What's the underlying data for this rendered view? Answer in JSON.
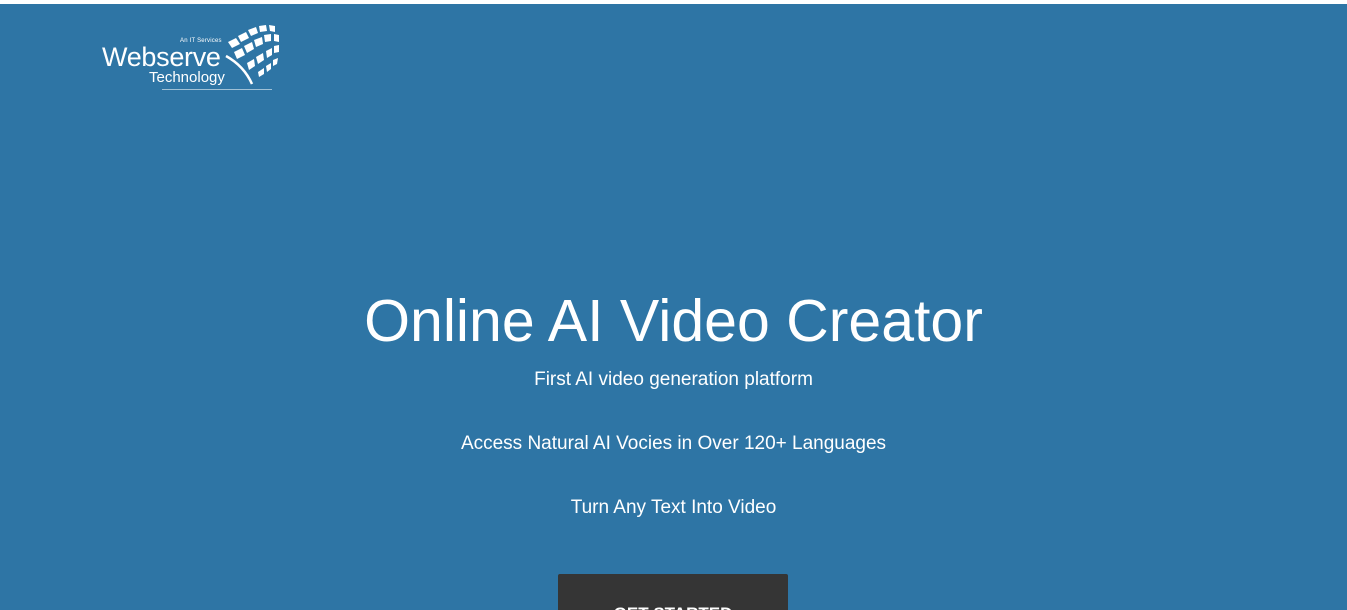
{
  "logo": {
    "tagline": "An IT Services",
    "main": "Webserve",
    "sub": "Technology",
    "icon": "grid-swoosh-logo-icon"
  },
  "hero": {
    "background": "#2e75a5",
    "headline": "Online AI Video Creator",
    "lines": [
      "First AI video generation platform",
      "Access Natural AI Vocies in Over 120+ Languages",
      "Turn Any Text Into Video"
    ],
    "cta_label": "GET STARTED",
    "cta_color": "#353535"
  }
}
